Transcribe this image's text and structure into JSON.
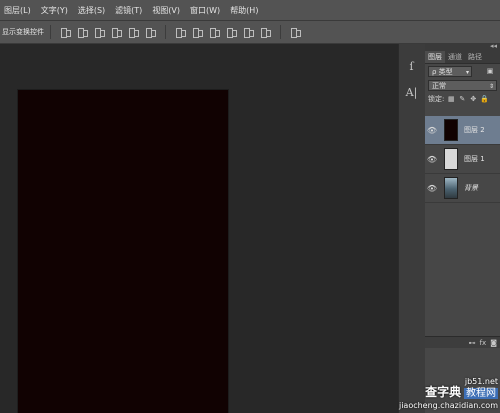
{
  "menu": {
    "items": [
      "图层(L)",
      "文字(Y)",
      "选择(S)",
      "滤镜(T)",
      "视图(V)",
      "窗口(W)",
      "帮助(H)"
    ]
  },
  "options": {
    "label": "显示变换控件"
  },
  "strip": {
    "btn1_icon": "character-style-icon",
    "btn2_icon": "paragraph-icon",
    "btn1_text": "ſ",
    "btn2_text": "A|"
  },
  "layers_panel": {
    "tabs": [
      "图层",
      "通道",
      "路径"
    ],
    "filter_value": "ρ 类型",
    "blend_mode": "正常",
    "lock_label": "锁定:",
    "layers": [
      {
        "name": "图层 2",
        "selected": true,
        "thumb_color": "#110202"
      },
      {
        "name": "图层 1",
        "selected": false,
        "thumb_color": "#d8d8d8"
      },
      {
        "name": "背景",
        "selected": false,
        "thumb_color": "#6f8a9a"
      }
    ],
    "footer_icons": [
      "link-icon",
      "fx-icon",
      "mask-icon"
    ]
  },
  "colors": {
    "document": "#110202",
    "selection": "#6e7d90",
    "chrome": "#535353"
  },
  "watermark": {
    "main": "查字典",
    "box": "教程网",
    "url": "jb51.net",
    "sub": "jiaocheng.chazidian.com"
  }
}
